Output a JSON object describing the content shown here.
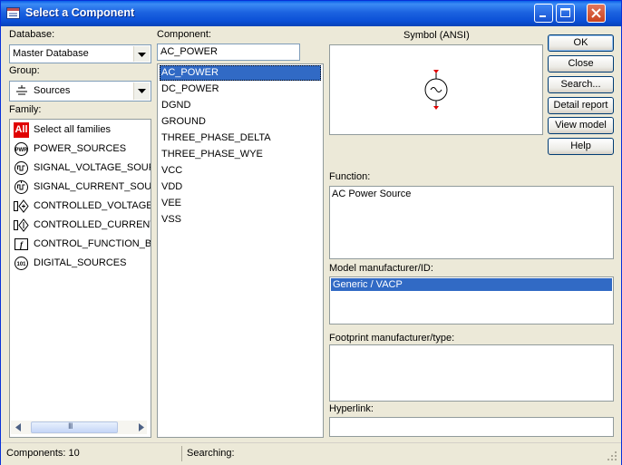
{
  "window": {
    "title": "Select a Component",
    "minimize_label": "minimize",
    "maximize_label": "maximize",
    "close_label": "close"
  },
  "database": {
    "label": "Database:",
    "value": "Master Database"
  },
  "group": {
    "label": "Group:",
    "value": "Sources"
  },
  "family": {
    "label": "Family:",
    "items": [
      {
        "label": "Select all families",
        "icon": "all-families-icon"
      },
      {
        "label": "POWER_SOURCES",
        "icon": "power-sources-icon"
      },
      {
        "label": "SIGNAL_VOLTAGE_SOURC",
        "icon": "signal-voltage-icon"
      },
      {
        "label": "SIGNAL_CURRENT_SOURC",
        "icon": "signal-current-icon"
      },
      {
        "label": "CONTROLLED_VOLTAGE_S",
        "icon": "controlled-voltage-icon"
      },
      {
        "label": "CONTROLLED_CURRENT_S",
        "icon": "controlled-current-icon"
      },
      {
        "label": "CONTROL_FUNCTION_BLO",
        "icon": "control-function-icon"
      },
      {
        "label": "DIGITAL_SOURCES",
        "icon": "digital-sources-icon"
      }
    ],
    "all_badge": "All",
    "scroll_grip": "III"
  },
  "component": {
    "label": "Component:",
    "value": "AC_POWER",
    "items": [
      "AC_POWER",
      "DC_POWER",
      "DGND",
      "GROUND",
      "THREE_PHASE_DELTA",
      "THREE_PHASE_WYE",
      "VCC",
      "VDD",
      "VEE",
      "VSS"
    ],
    "selected": "AC_POWER"
  },
  "symbol": {
    "label": "Symbol (ANSI)"
  },
  "function": {
    "label": "Function:",
    "value": "AC Power Source"
  },
  "model": {
    "label": "Model manufacturer/ID:",
    "value": "Generic / VACP"
  },
  "footprint": {
    "label": "Footprint manufacturer/type:"
  },
  "hyperlink": {
    "label": "Hyperlink:"
  },
  "buttons": {
    "ok": "OK",
    "close": "Close",
    "search": "Search...",
    "detail_report": "Detail report",
    "view_model": "View model",
    "help": "Help"
  },
  "status": {
    "components": "Components: 10",
    "searching": "Searching:"
  },
  "colors": {
    "title_bar": "#1c63e0",
    "selection": "#316ac5",
    "dialog_bg": "#ece9d8",
    "all_badge": "#e00000"
  }
}
